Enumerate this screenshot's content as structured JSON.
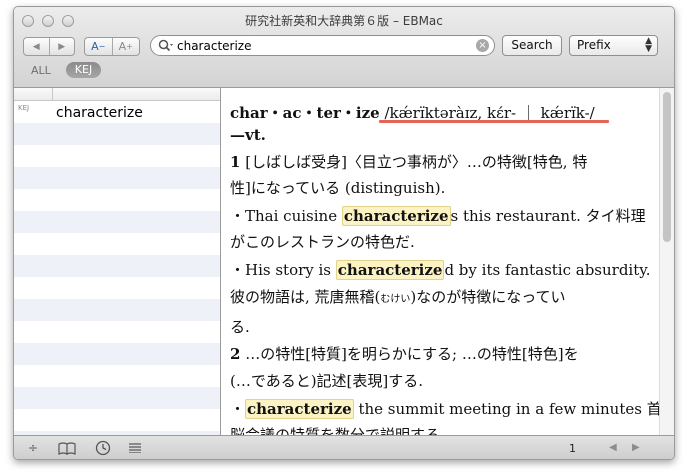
{
  "window": {
    "title": "研究社新英和大辞典第６版 – EBMac"
  },
  "toolbar": {
    "back_icon": "◀",
    "forward_icon": "▶",
    "font_smaller": "A",
    "font_larger": "A",
    "search_value": "characterize",
    "search_button": "Search",
    "match_mode": "Prefix"
  },
  "scope": {
    "all": "ALL",
    "kej": "KEJ"
  },
  "results": [
    {
      "tag": "KEJ",
      "word": "characterize"
    }
  ],
  "entry": {
    "headword": "char・ac・ter・ize",
    "pronunciation": "/kǽrɪ̈ktəràɪz, kɛ́r- ｜ kǽrɪ̈k-/",
    "pos": "—vt.",
    "sense1_num": "1",
    "sense1_a": "[しばしば受身]〈目立つ事柄が〉…の特徴[特色, 特",
    "sense1_b": "性]になっている (distinguish).",
    "ex1_a_pre": "・Thai cuisine ",
    "ex1_a_hl": "characterize",
    "ex1_a_post": "s this restaurant. タイ料理",
    "ex1_b": "がこのレストランの特色だ.",
    "ex2_a_pre": "・His story is ",
    "ex2_a_hl": "characterize",
    "ex2_a_post": "d by its fantastic absurdity.",
    "ex2_b_pre": "彼の物語は, 荒唐無稽(",
    "ex2_b_ruby": "むけい",
    "ex2_b_post": ")なのが特徴になってい",
    "ex2_c": "る.",
    "sense2_num": "2",
    "sense2_a": " …の特性[特質]を明らかにする; …の特性[特色]を",
    "sense2_b": "(…であると)記述[表現]する.",
    "ex3_a_pre": "・",
    "ex3_a_hl": "characterize",
    "ex3_a_post": " the summit meeting in a few minutes 首",
    "ex3_b": "脳会議の特質を数分で説明する."
  },
  "statusbar": {
    "page": "1"
  }
}
